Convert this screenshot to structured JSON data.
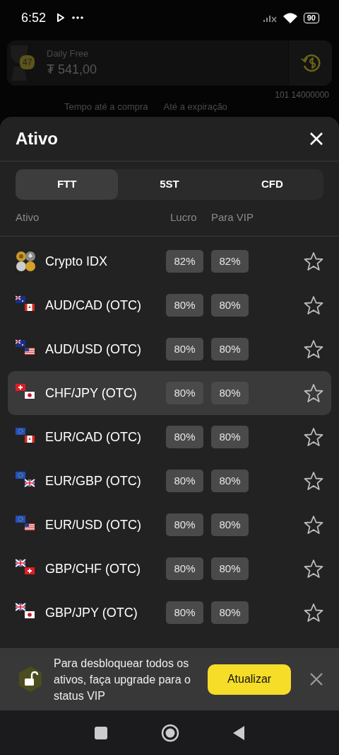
{
  "status_bar": {
    "time": "6:52",
    "battery": "90"
  },
  "background": {
    "level": "47",
    "account_name": "Daily Free",
    "balance": "₮ 541,00",
    "counter": "101 14000000",
    "columns": [
      "Tempo até a compra",
      "Até a expiração"
    ]
  },
  "sheet": {
    "title": "Ativo",
    "tabs": [
      {
        "label": "FTT",
        "selected": true
      },
      {
        "label": "5ST",
        "selected": false
      },
      {
        "label": "CFD",
        "selected": false
      }
    ],
    "columns": [
      "Ativo",
      "Lucro",
      "Para VIP"
    ],
    "assets": [
      {
        "name": "Crypto IDX",
        "profit": "82%",
        "vip_profit": "82%",
        "selected": false,
        "favorite": false
      },
      {
        "name": "AUD/CAD (OTC)",
        "profit": "80%",
        "vip_profit": "80%",
        "selected": false,
        "favorite": false
      },
      {
        "name": "AUD/USD (OTC)",
        "profit": "80%",
        "vip_profit": "80%",
        "selected": false,
        "favorite": false
      },
      {
        "name": "CHF/JPY (OTC)",
        "profit": "80%",
        "vip_profit": "80%",
        "selected": true,
        "favorite": false
      },
      {
        "name": "EUR/CAD (OTC)",
        "profit": "80%",
        "vip_profit": "80%",
        "selected": false,
        "favorite": false
      },
      {
        "name": "EUR/GBP (OTC)",
        "profit": "80%",
        "vip_profit": "80%",
        "selected": false,
        "favorite": false
      },
      {
        "name": "EUR/USD (OTC)",
        "profit": "80%",
        "vip_profit": "80%",
        "selected": false,
        "favorite": false
      },
      {
        "name": "GBP/CHF (OTC)",
        "profit": "80%",
        "vip_profit": "80%",
        "selected": false,
        "favorite": false
      },
      {
        "name": "GBP/JPY (OTC)",
        "profit": "80%",
        "vip_profit": "80%",
        "selected": false,
        "favorite": false
      }
    ]
  },
  "banner": {
    "message": "Para desbloquear todos os ativos, faça upgrade para o status VIP",
    "button": "Atualizar"
  }
}
